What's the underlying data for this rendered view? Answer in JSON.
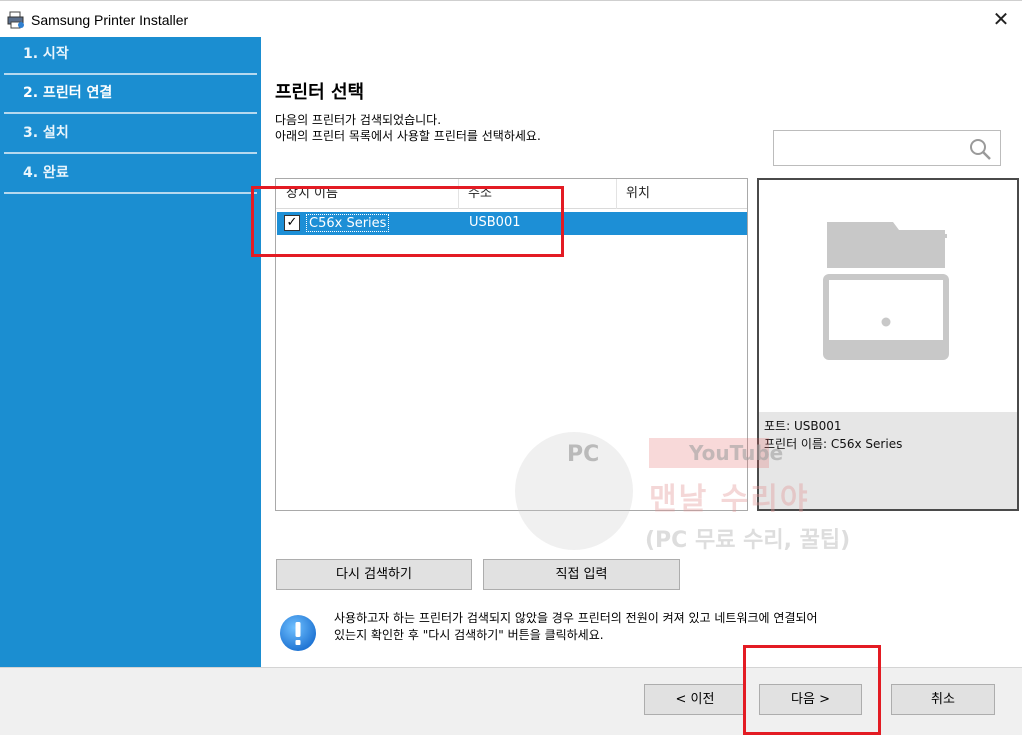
{
  "window": {
    "title": "Samsung Printer Installer",
    "close_glyph": "✕"
  },
  "sidebar": {
    "steps": [
      {
        "label": "1. 시작"
      },
      {
        "label": "2. 프린터 연결",
        "active": true
      },
      {
        "label": "3. 설치"
      },
      {
        "label": "4. 완료"
      }
    ]
  },
  "main": {
    "title": "프린터 선택",
    "desc_line1": "다음의 프린터가 검색되었습니다.",
    "desc_line2": "아래의 프린터 목록에서 사용할 프린터를 선택하세요.",
    "search": {
      "placeholder": "",
      "icon": "search-icon"
    }
  },
  "printer_list": {
    "columns": [
      "장치 이름",
      "주소",
      "위치"
    ],
    "rows": [
      {
        "checked": true,
        "check_glyph": "✓",
        "name": "C56x Series",
        "port": "USB001",
        "location": "",
        "selected": true
      }
    ]
  },
  "preview": {
    "port_line": "포트: USB001",
    "name_line": "프린터 이름: C56x Series"
  },
  "buttons": {
    "research": "다시 검색하기",
    "direct_input": "직접 입력",
    "back": "< 이전",
    "next": "다음 >",
    "cancel": "취소"
  },
  "notice": {
    "line1": "사용하고자 하는 프린터가 검색되지 않았을 경우 프린터의 전원이 켜져 있고 네트워크에 연결되어",
    "line2": "있는지 확인한 후 \"다시 검색하기\" 버튼을 클릭하세요."
  },
  "watermark": {
    "pc": "PC",
    "youtube": "YouTube",
    "main": "맨날 수리야",
    "sub": "(PC 무료 수리, 꿀팁)"
  },
  "colors": {
    "sidebar": "#1b8ed1",
    "selection": "#1d8fd6",
    "highlight_box": "#e31b23"
  }
}
